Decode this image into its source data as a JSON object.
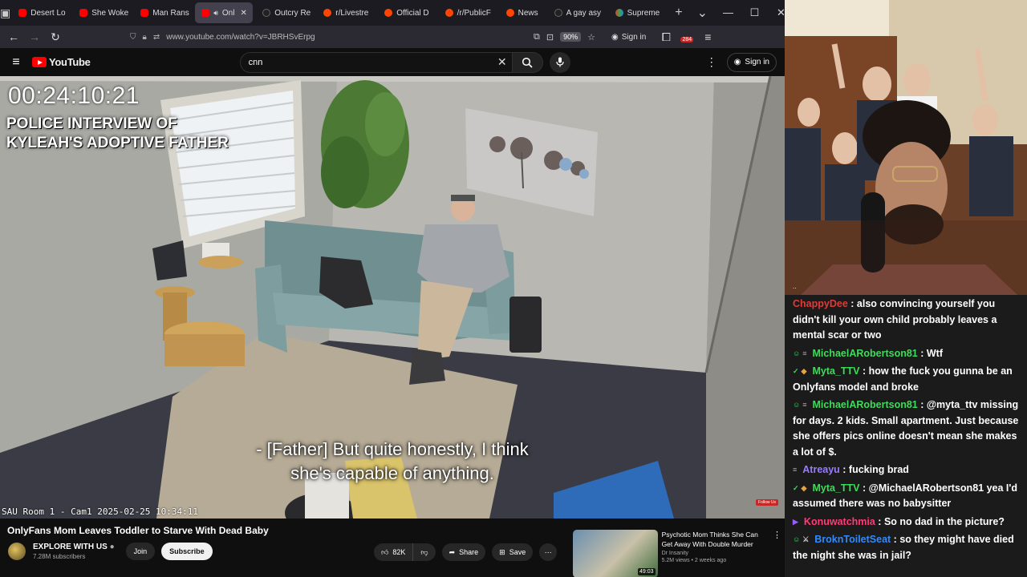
{
  "browser": {
    "tabs": [
      {
        "title": "Desert Lo",
        "icon": "youtube-icon",
        "active": false
      },
      {
        "title": "She Woke",
        "icon": "youtube-icon",
        "active": false
      },
      {
        "title": "Man Rans",
        "icon": "youtube-icon",
        "active": false
      },
      {
        "title": "Onl",
        "icon": "youtube-icon",
        "active": true
      },
      {
        "title": "Outcry Re",
        "icon": "yf-icon",
        "active": false
      },
      {
        "title": "r/Livestre",
        "icon": "reddit-icon",
        "active": false
      },
      {
        "title": "Official D",
        "icon": "reddit-icon",
        "active": false
      },
      {
        "title": "/r/PublicF",
        "icon": "reddit-icon",
        "active": false
      },
      {
        "title": "News",
        "icon": "reddit-icon",
        "active": false
      },
      {
        "title": "A gay asy",
        "icon": "ap-icon",
        "active": false
      },
      {
        "title": "Supreme",
        "icon": "google-news-icon",
        "active": false
      }
    ],
    "url": "www.youtube.com/watch?v=JBRHSvErpg",
    "zoom": "90%",
    "signin_label": "Sign in",
    "notification_count": "284"
  },
  "youtube": {
    "search_value": "cnn",
    "signin_label": "Sign in",
    "logo_text": "YouTube"
  },
  "video": {
    "timestamp": "00:24:10:21",
    "overlay_line1": "POLICE INTERVIEW OF",
    "overlay_line2": "KYLEAH'S ADOPTIVE FATHER",
    "caption_line1": "- [Father] But quite honestly, I think",
    "caption_line2": "she's capable of anything.",
    "cam_label": "SAU Room 1 - Cam1 2025-02-25 10:34:11",
    "follow_badge": "Follow Us"
  },
  "info": {
    "title": "OnlyFans Mom Leaves Toddler to Starve With Dead Baby",
    "channel_name": "EXPLORE WITH US",
    "subscribers": "7.28M subscribers",
    "join_label": "Join",
    "subscribe_label": "Subscribe",
    "likes": "82K",
    "share_label": "Share",
    "save_label": "Save"
  },
  "recommended": {
    "title": "Psychotic Mom Thinks She Can Get Away With Double Murder",
    "channel": "Dr Insanity",
    "views": "5.2M views • 2 weeks ago",
    "duration": "49:03"
  },
  "chat": [
    {
      "user": "ChappyDee",
      "color": "#e53935",
      "badges": [],
      "text": "also convincing yourself you didn't kill your own child probably leaves a mental scar or two"
    },
    {
      "user": "MichaelARobertson81",
      "color": "#3ddc5a",
      "badges": [
        "person",
        "sub"
      ],
      "text": "Wtf"
    },
    {
      "user": "Myta_TTV",
      "color": "#3ddc5a",
      "badges": [
        "check",
        "gift"
      ],
      "text": "how the fuck you gunna be an Onlyfans model and broke"
    },
    {
      "user": "MichaelARobertson81",
      "color": "#3ddc5a",
      "badges": [
        "person",
        "sub"
      ],
      "text": "@myta_ttv missing for days. 2 kids. Small apartment. Just because she offers pics online doesn't mean she makes a lot of $."
    },
    {
      "user": "Atreayu",
      "color": "#9b7bff",
      "badges": [
        "sub"
      ],
      "text": "fucking brad"
    },
    {
      "user": "Myta_TTV",
      "color": "#3ddc5a",
      "badges": [
        "check",
        "gift"
      ],
      "text": "@MichaelARobertson81 yea I'd assumed there was no babysitter"
    },
    {
      "user": "Konuwatchmia",
      "color": "#ff3b7a",
      "badges": [
        "prime"
      ],
      "text": "So no dad in the picture?"
    },
    {
      "user": "BroknToiletSeat",
      "color": "#2f8bff",
      "badges": [
        "person",
        "sword"
      ],
      "text": "so they might have died the night she was in jail?"
    }
  ],
  "colors": {
    "youtube_red": "#ff0000",
    "browser_tabbar": "#1c1b22",
    "chat_bg": "#1b1b1b"
  }
}
